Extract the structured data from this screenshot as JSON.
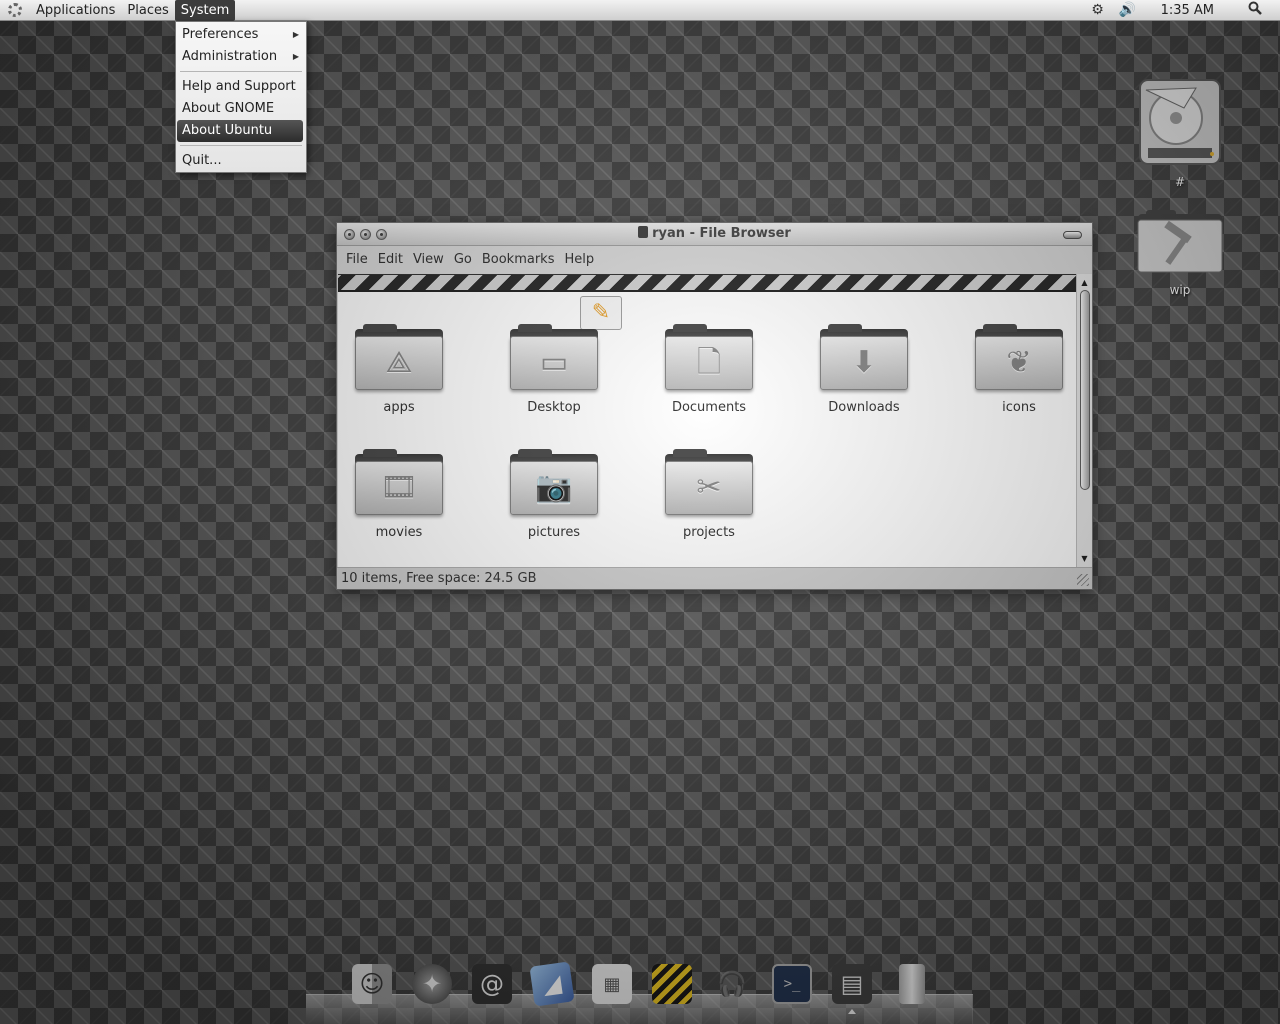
{
  "top_panel": {
    "menus": [
      "Applications",
      "Places",
      "System"
    ],
    "clock": "1:35 AM",
    "icons": [
      "gnome-foot-icon",
      "settings-icon",
      "volume-icon",
      "search-icon"
    ]
  },
  "system_menu": {
    "items": [
      {
        "label": "Preferences",
        "submenu": true
      },
      {
        "label": "Administration",
        "submenu": true
      },
      {
        "label": "Help and Support"
      },
      {
        "label": "About GNOME"
      },
      {
        "label": "About Ubuntu",
        "highlighted": true
      },
      {
        "label": "Quit..."
      }
    ]
  },
  "desktop": {
    "icons": [
      {
        "label": "#",
        "icon": "hard-drive-icon"
      },
      {
        "label": "wip",
        "icon": "hammer-folder-icon"
      }
    ]
  },
  "window": {
    "title": "ryan - File Browser",
    "menu": [
      "File",
      "Edit",
      "View",
      "Go",
      "Bookmarks",
      "Help"
    ],
    "status": "10 items, Free space: 24.5 GB",
    "items": [
      {
        "label": "apps",
        "icon": "apps-icon"
      },
      {
        "label": "Desktop",
        "icon": "desktop-icon"
      },
      {
        "label": "Documents",
        "icon": "document-icon"
      },
      {
        "label": "Downloads",
        "icon": "download-icon"
      },
      {
        "label": "icons",
        "icon": "phoenix-icon"
      },
      {
        "label": "movies",
        "icon": "film-icon"
      },
      {
        "label": "pictures",
        "icon": "camera-icon"
      },
      {
        "label": "projects",
        "icon": "tools-icon"
      }
    ]
  },
  "dock": {
    "items": [
      "finder-icon",
      "safari-icon",
      "address-book-icon",
      "preview-icon",
      "calculator-icon",
      "archive-icon",
      "itunes-icon",
      "terminal-icon",
      "file-browser-icon",
      "trash-icon"
    ]
  },
  "colors": {
    "menu_highlight": "#3c3c3c",
    "accent": "#e59a1e"
  }
}
